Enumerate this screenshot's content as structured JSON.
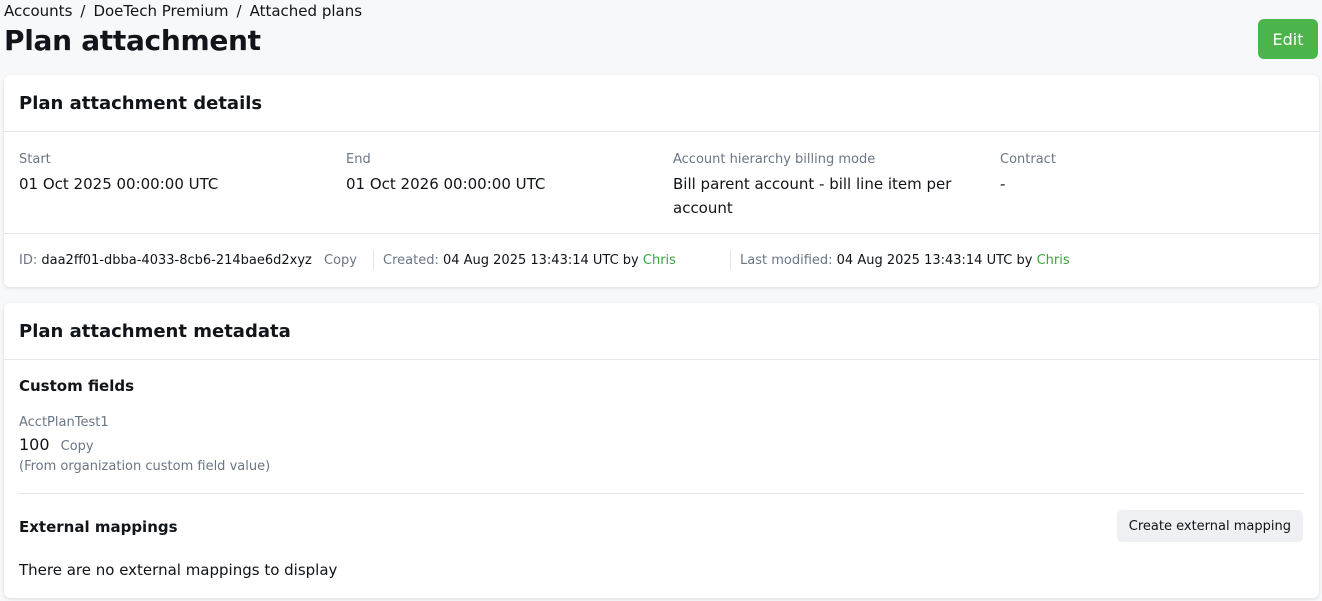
{
  "breadcrumb": [
    "Accounts",
    "DoeTech Premium",
    "Attached plans"
  ],
  "breadcrumb_separator": "/",
  "page_title": "Plan attachment",
  "edit_label": "Edit",
  "details": {
    "title": "Plan attachment details",
    "fields": [
      {
        "label": "Start",
        "value": "01 Oct 2025 00:00:00 UTC"
      },
      {
        "label": "End",
        "value": "01 Oct 2026 00:00:00 UTC"
      },
      {
        "label": "Account hierarchy billing mode",
        "value": "Bill parent account - bill line item per account"
      },
      {
        "label": "Contract",
        "value": "-"
      }
    ],
    "meta": {
      "id_label": "ID:",
      "id_value": "daa2ff01-dbba-4033-8cb6-214bae6d2xyz",
      "copy_label": "Copy",
      "created_label": "Created:",
      "created_value": "04 Aug 2025 13:43:14 UTC by",
      "created_by": "Chris",
      "modified_label": "Last modified:",
      "modified_value": "04 Aug 2025 13:43:14 UTC by",
      "modified_by": "Chris"
    }
  },
  "metadata": {
    "title": "Plan attachment metadata",
    "custom_fields_title": "Custom fields",
    "custom_field": {
      "name": "AcctPlanTest1",
      "value": "100",
      "copy_label": "Copy",
      "note": "(From organization custom field value)"
    },
    "external_title": "External mappings",
    "create_button": "Create external mapping",
    "empty_text": "There are no external mappings to display"
  },
  "colors": {
    "accent": "#4bb44b",
    "user_link": "#3aa63a",
    "muted": "#6b7685"
  }
}
